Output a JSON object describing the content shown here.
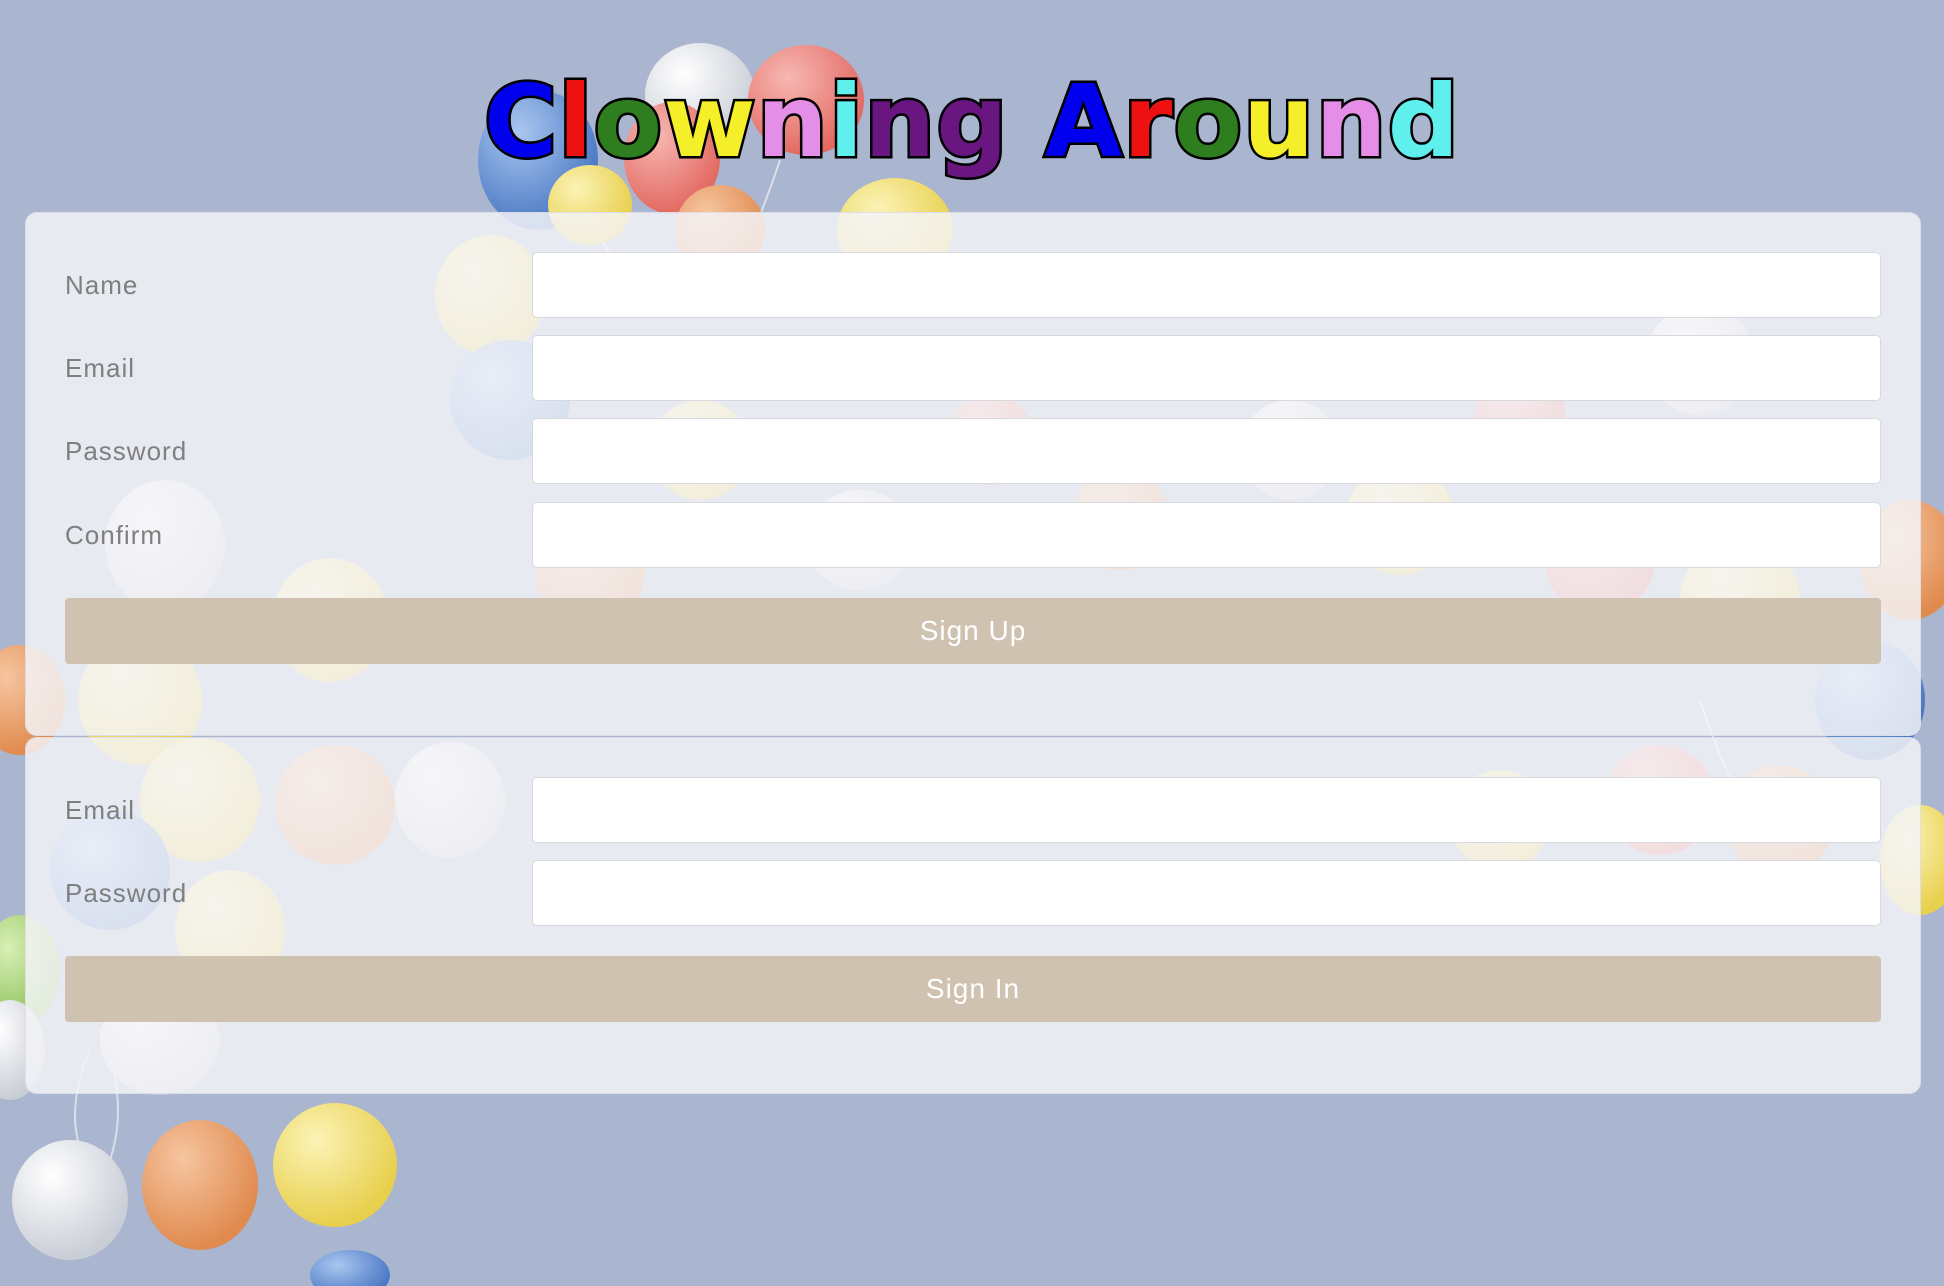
{
  "app": {
    "title": "Clowning Around",
    "title_letters": [
      {
        "char": "C",
        "color": "#0000ee"
      },
      {
        "char": "l",
        "color": "#ee1111"
      },
      {
        "char": "o",
        "color": "#2e7d1e"
      },
      {
        "char": "w",
        "color": "#f5ef2a"
      },
      {
        "char": "n",
        "color": "#e58ee8"
      },
      {
        "char": "i",
        "color": "#5ff0ee"
      },
      {
        "char": "n",
        "color": "#6a1680"
      },
      {
        "char": "g",
        "color": "#6a1680"
      },
      {
        "char": " ",
        "color": "#000000"
      },
      {
        "char": "A",
        "color": "#0000ee"
      },
      {
        "char": "r",
        "color": "#ee1111"
      },
      {
        "char": "o",
        "color": "#2e7d1e"
      },
      {
        "char": "u",
        "color": "#f5ef2a"
      },
      {
        "char": "n",
        "color": "#e58ee8"
      },
      {
        "char": "d",
        "color": "#5ff0ee"
      }
    ]
  },
  "signup": {
    "fields": [
      {
        "label": "Name",
        "value": "",
        "placeholder": ""
      },
      {
        "label": "Email",
        "value": "",
        "placeholder": ""
      },
      {
        "label": "Password",
        "value": "",
        "placeholder": ""
      },
      {
        "label": "Confirm",
        "value": "",
        "placeholder": ""
      }
    ],
    "button_label": "Sign Up"
  },
  "signin": {
    "fields": [
      {
        "label": "Email",
        "value": "",
        "placeholder": ""
      },
      {
        "label": "Password",
        "value": "",
        "placeholder": ""
      }
    ],
    "button_label": "Sign In"
  },
  "colors": {
    "background": "#aab5d0",
    "card": "#f4f4f8",
    "button": "#cfc2b1",
    "button_text": "#ffffff",
    "label_text": "#7f7f7f"
  },
  "background_image": "balloons"
}
